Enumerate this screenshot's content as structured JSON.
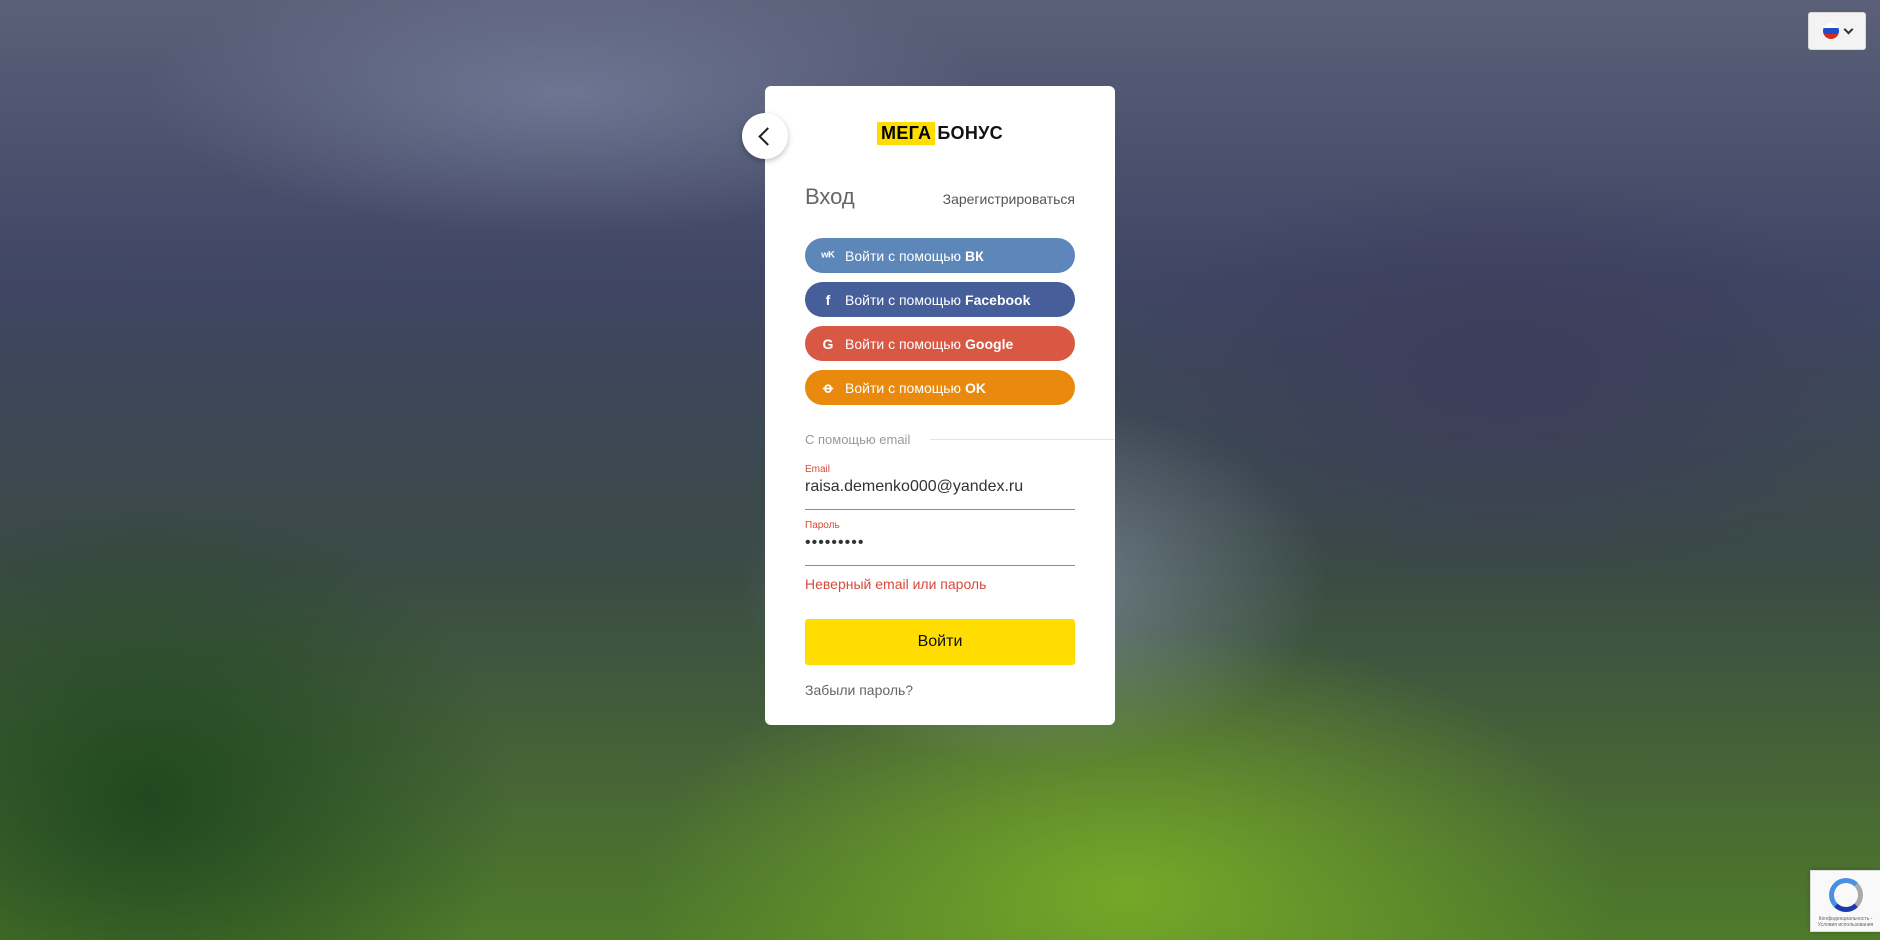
{
  "header": {
    "language_icon": "flag-ru-icon",
    "language_colors": [
      "#ffffff",
      "#1f4fc8",
      "#d52b1e"
    ]
  },
  "card": {
    "logo": {
      "part1": "МЕГА",
      "part2": "БОНУС"
    },
    "title": "Вход",
    "register_link": "Зарегистрироваться",
    "social": {
      "vk": {
        "prefix": "Войти с помощью",
        "brand": "ВК",
        "color": "#5e87b9"
      },
      "facebook": {
        "prefix": "Войти с помощью",
        "brand": "Facebook",
        "color": "#465e99"
      },
      "google": {
        "prefix": "Войти с помощью",
        "brand": "Google",
        "color": "#d95844"
      },
      "ok": {
        "prefix": "Войти с помощью",
        "brand": "OK",
        "color": "#e98a0e"
      }
    },
    "separator": "С помощью email",
    "email": {
      "label": "Email",
      "value": "raisa.demenko000@yandex.ru"
    },
    "password": {
      "label": "Пароль",
      "value": "•••••••••"
    },
    "error": "Неверный email или пароль",
    "submit_label": "Войти",
    "forgot_link": "Забыли пароль?",
    "accent_color": "#ffdd00",
    "error_color": "#d84a3a"
  },
  "captcha": {
    "text": "Конфиденциальность - Условия использования"
  }
}
